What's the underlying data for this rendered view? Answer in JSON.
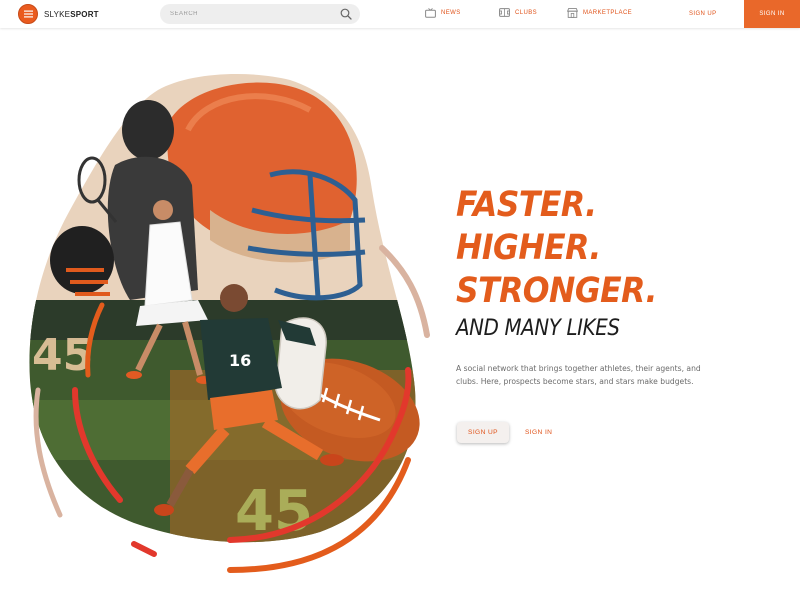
{
  "brand": {
    "name_light": "SLYKE",
    "name_bold": "SPORT",
    "accent": "#e35c1c",
    "logo_icon": "hamburger-menu-icon"
  },
  "search": {
    "placeholder": "SEARCH",
    "value": "",
    "icon": "search-icon"
  },
  "nav": {
    "items": [
      {
        "label": "NEWS",
        "icon": "tv-icon"
      },
      {
        "label": "CLUBS",
        "icon": "stadium-icon"
      },
      {
        "label": "MARKETPLACE",
        "icon": "storefront-icon"
      }
    ],
    "sign_up": "SIGN UP",
    "sign_in": "SIGN IN",
    "sign_in_bg": "#e9682a"
  },
  "hero": {
    "headline": [
      "FASTER.",
      "HIGHER.",
      "STRONGER."
    ],
    "subheadline": "AND MANY LIKES",
    "description": "A social network that brings together athletes, their agents, and clubs. Here, prospects become stars, and stars make budgets.",
    "cta_primary": "SIGN UP",
    "cta_secondary": "SIGN IN",
    "jersey_number": "16",
    "field_number": "45",
    "colors": {
      "orange": "#e35c1c",
      "red": "#e2382c",
      "beige": "#d9b3a0"
    }
  }
}
